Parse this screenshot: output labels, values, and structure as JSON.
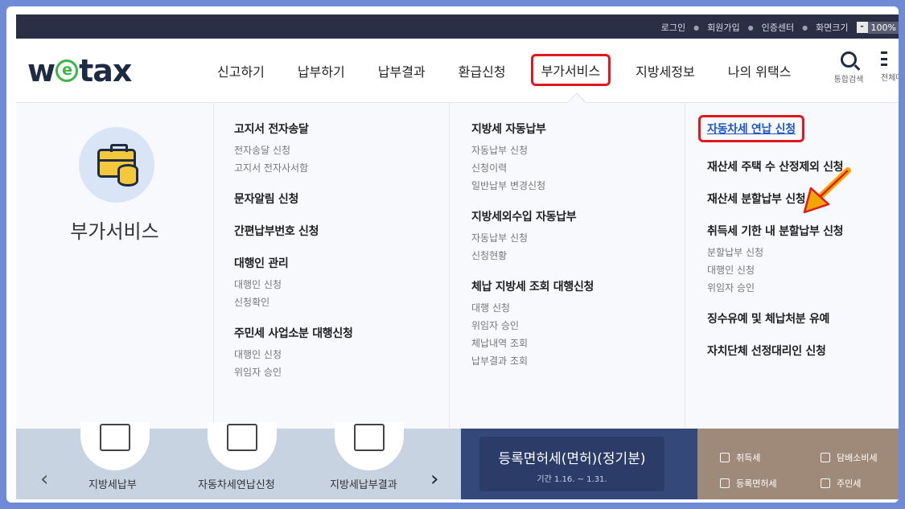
{
  "utility_bar": {
    "items": [
      "로그인",
      "회원가입",
      "인증센터",
      "화면크기"
    ],
    "zoom_minus": "-",
    "zoom_value": "100%"
  },
  "header": {
    "logo_left": "w",
    "logo_e": "e",
    "logo_right": "tax",
    "nav": [
      "신고하기",
      "납부하기",
      "납부결과",
      "환급신청",
      "부가서비스",
      "지방세정보",
      "나의 위택스"
    ],
    "active_nav": "부가서비스",
    "search_label": "통합검색",
    "allmenu_label": "전체메뉴"
  },
  "mega_menu": {
    "section_title": "부가서비스",
    "columns": [
      [
        {
          "title": "고지서 전자송달",
          "subs": [
            "전자송달 신청",
            "고지서 전자사서함"
          ]
        },
        {
          "title": "문자알림 신청",
          "subs": []
        },
        {
          "title": "간편납부번호 신청",
          "subs": []
        },
        {
          "title": "대행인 관리",
          "subs": [
            "대행인 신청",
            "신청확인"
          ]
        },
        {
          "title": "주민세 사업소분 대행신청",
          "subs": [
            "대행인 신청",
            "위임자 승인"
          ]
        }
      ],
      [
        {
          "title": "지방세 자동납부",
          "subs": [
            "자동납부 신청",
            "신청이력",
            "일반납부 변경신청"
          ]
        },
        {
          "title": "지방세외수입 자동납부",
          "subs": [
            "자동납부 신청",
            "신청현황"
          ]
        },
        {
          "title": "체납 지방세 조회 대행신청",
          "subs": [
            "대행 신청",
            "위임자 승인",
            "체납내역 조회",
            "납부결과 조회"
          ]
        }
      ],
      [
        {
          "title": "자동차세 연납 신청",
          "subs": [],
          "highlight": true
        },
        {
          "title": "재산세 주택 수 산정제외 신청",
          "subs": []
        },
        {
          "title": "재산세 분할납부 신청",
          "subs": []
        },
        {
          "title": "취득세 기한 내 분할납부 신청",
          "subs": [
            "분할납부 신청",
            "대행인 신청",
            "위임자 승인"
          ]
        },
        {
          "title": "징수유예 및 체납처분 유예",
          "subs": []
        },
        {
          "title": "자치단체 선정대리인 신청",
          "subs": []
        }
      ]
    ]
  },
  "bottom": {
    "quick_labels": [
      "지방세납부",
      "자동차세연납신청",
      "지방세납부결과"
    ],
    "promo_title": "등록면허세(면허)(정기분)",
    "promo_sub": "기간 1.16. ~ 1.31.",
    "quick_links": [
      "취득세",
      "담배소비세",
      "등록면허세",
      "주민세"
    ]
  },
  "colors": {
    "highlight_border": "#e0191f",
    "link_blue": "#1e56c8",
    "navy": "#1f2a44",
    "arrow": "#f0a800"
  }
}
